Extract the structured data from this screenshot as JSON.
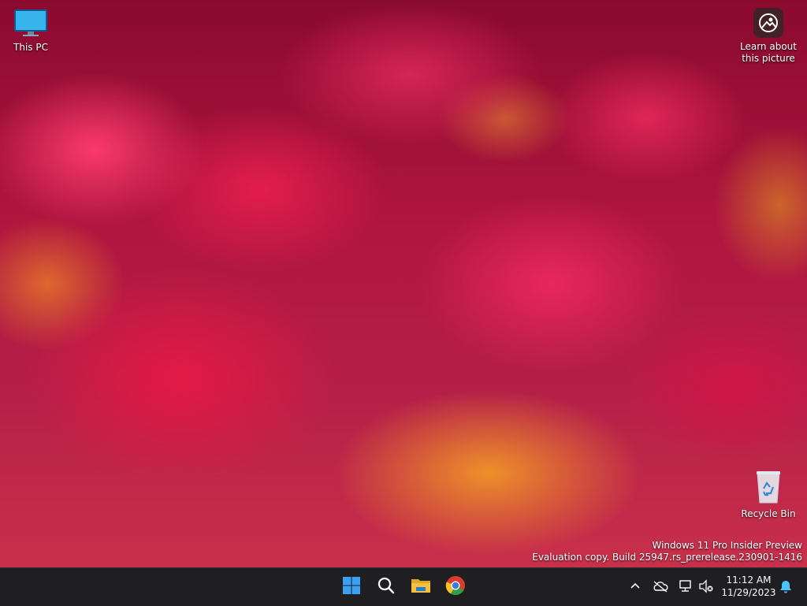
{
  "desktop": {
    "icons": [
      {
        "label": "This PC",
        "icon": "monitor-icon"
      },
      {
        "label": "Recycle Bin",
        "icon": "recycle-bin-icon"
      }
    ],
    "learn_picture": {
      "line1": "Learn about",
      "line2": "this picture",
      "icon": "camera-spotlight-icon"
    }
  },
  "watermark": {
    "line1": "Windows 11 Pro Insider Preview",
    "line2": "Evaluation copy. Build 25947.rs_prerelease.230901-1416"
  },
  "taskbar": {
    "apps": [
      {
        "name": "Start",
        "icon": "windows-logo-icon"
      },
      {
        "name": "Search",
        "icon": "search-icon"
      },
      {
        "name": "File Explorer",
        "icon": "folder-icon"
      },
      {
        "name": "Google Chrome",
        "icon": "chrome-icon"
      }
    ],
    "tray": {
      "icons": [
        "chevron-up-icon",
        "cloud-offline-icon",
        "network-icon",
        "volume-muted-icon",
        "notification-bell-icon"
      ],
      "time": "11:12 AM",
      "date": "11/29/2023"
    }
  },
  "colors": {
    "taskbar_bg": "#1f1f22",
    "accent_blue": "#3aa0f2",
    "folder_yellow": "#f5c13a"
  }
}
